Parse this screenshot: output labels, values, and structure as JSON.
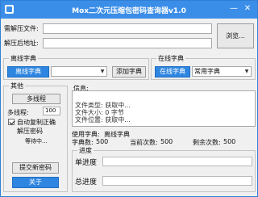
{
  "window": {
    "title": "Mox二次元压缩包密码查询器v1.0",
    "minimize_glyph": "—",
    "close_glyph": "✕"
  },
  "file_row": {
    "target_label": "需解压文件:",
    "target_value": "",
    "output_label": "解压后地址:",
    "output_value": "",
    "browse_label": "浏览..."
  },
  "offline_dict": {
    "legend": "离线字典",
    "button_label": "离线字典",
    "select_value": "",
    "add_label": "添加字典"
  },
  "online_dict": {
    "legend": "在线字典",
    "button_label": "在线字典",
    "select_value": "常用字典"
  },
  "other": {
    "legend": "其他",
    "multithread_label": "多线程",
    "threads_label": "多线程:",
    "threads_value": "100",
    "auto_copy_label": "自动复制正确",
    "auto_copy_checked": true,
    "unzip_label": "解压密码",
    "waiting_label": "等待中...",
    "submit_label": "提交新密码",
    "about_label": "关于"
  },
  "info": {
    "legend": "信息:",
    "lines": [
      "文件类型: 获取中...",
      "文件大小: 0 字节",
      "文件位置: 获取中..."
    ]
  },
  "stats": {
    "dict_label": "使用字典:",
    "dict_value": "离线字典",
    "count_label": "字典数:",
    "count_value": "500",
    "current_label": "当前次数:",
    "current_value": "500",
    "remaining_label": "剩余次数:",
    "remaining_value": "500"
  },
  "progress": {
    "legend": "进度",
    "single_label": "单进度",
    "single_value": 0,
    "total_label": "总进度",
    "total_value": 0
  }
}
